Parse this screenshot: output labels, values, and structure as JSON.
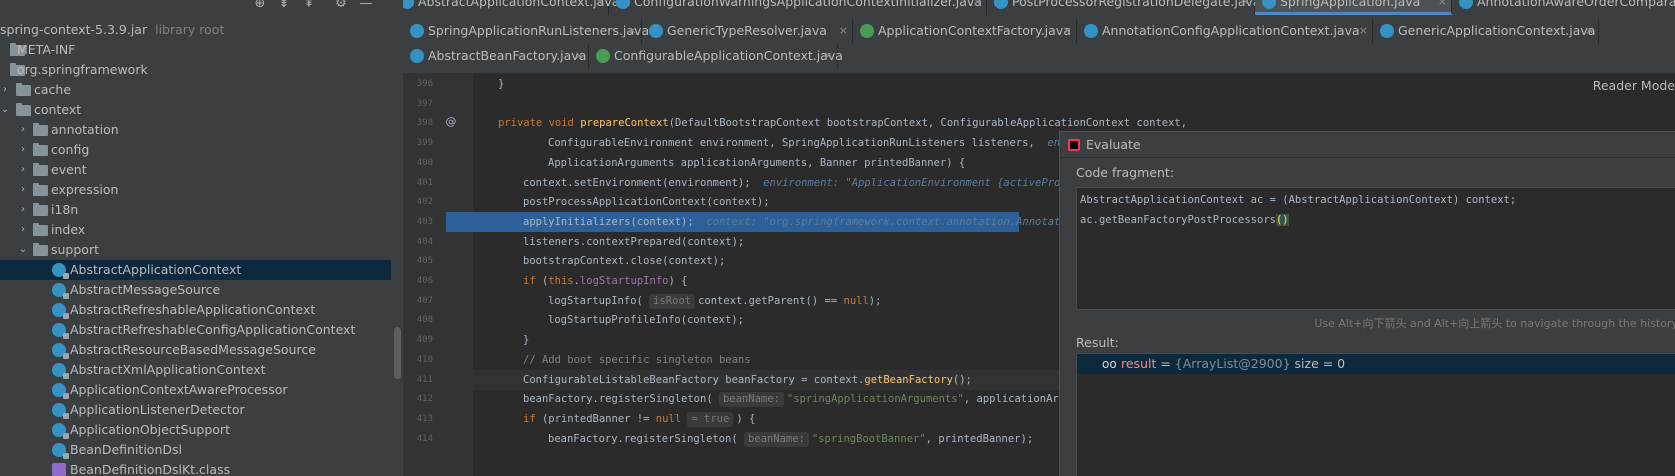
{
  "project": {
    "toolbar_icons": [
      "locate-icon",
      "collapse-all-icon",
      "expand-all-icon",
      "gear-icon",
      "minimize-icon"
    ],
    "tree": [
      {
        "label": "spring-context-5.3.9.jar",
        "sub": "library root",
        "icon": "jar-icon",
        "indent": 0,
        "arrow": ""
      },
      {
        "label": "META-INF",
        "icon": "folder-icon",
        "indent": 1,
        "arrow": ""
      },
      {
        "label": "org.springframework",
        "icon": "folder-icon",
        "indent": 1,
        "arrow": ""
      },
      {
        "label": "cache",
        "icon": "folder-icon",
        "indent": 1,
        "arrow": "›"
      },
      {
        "label": "context",
        "icon": "folder-icon",
        "indent": 1,
        "arrow": "⌄"
      },
      {
        "label": "annotation",
        "icon": "folder-icon",
        "indent": 2,
        "arrow": "›"
      },
      {
        "label": "config",
        "icon": "folder-icon",
        "indent": 2,
        "arrow": "›"
      },
      {
        "label": "event",
        "icon": "folder-icon",
        "indent": 2,
        "arrow": "›"
      },
      {
        "label": "expression",
        "icon": "folder-icon",
        "indent": 2,
        "arrow": "›"
      },
      {
        "label": "i18n",
        "icon": "folder-icon",
        "indent": 2,
        "arrow": "›"
      },
      {
        "label": "index",
        "icon": "folder-icon",
        "indent": 2,
        "arrow": "›"
      },
      {
        "label": "support",
        "icon": "folder-icon",
        "indent": 2,
        "arrow": "⌄"
      },
      {
        "label": "AbstractApplicationContext",
        "icon": "class-icon",
        "indent": 3,
        "arrow": "",
        "selected": true
      },
      {
        "label": "AbstractMessageSource",
        "icon": "class-icon",
        "indent": 3,
        "arrow": ""
      },
      {
        "label": "AbstractRefreshableApplicationContext",
        "icon": "class-icon",
        "indent": 3,
        "arrow": ""
      },
      {
        "label": "AbstractRefreshableConfigApplicationContext",
        "icon": "class-icon",
        "indent": 3,
        "arrow": ""
      },
      {
        "label": "AbstractResourceBasedMessageSource",
        "icon": "class-icon",
        "indent": 3,
        "arrow": ""
      },
      {
        "label": "AbstractXmlApplicationContext",
        "icon": "class-icon",
        "indent": 3,
        "arrow": ""
      },
      {
        "label": "ApplicationContextAwareProcessor",
        "icon": "class-icon",
        "indent": 3,
        "arrow": ""
      },
      {
        "label": "ApplicationListenerDetector",
        "icon": "class-icon",
        "indent": 3,
        "arrow": ""
      },
      {
        "label": "ApplicationObjectSupport",
        "icon": "class-icon",
        "indent": 3,
        "arrow": ""
      },
      {
        "label": "BeanDefinitionDsl",
        "icon": "class-icon",
        "indent": 3,
        "arrow": ""
      },
      {
        "label": "BeanDefinitionDslKt.class",
        "icon": "kotlin-class-icon",
        "indent": 3,
        "arrow": ""
      }
    ]
  },
  "tabs": {
    "row1": [
      {
        "label": "AbstractApplicationContext.java",
        "icon": "class",
        "active": false
      },
      {
        "label": "ConfigurationWarningsApplicationContextInitializer.java",
        "icon": "class",
        "active": false
      },
      {
        "label": "PostProcessorRegistrationDelegate.java",
        "icon": "class",
        "active": false
      },
      {
        "label": "SpringApplication.java",
        "icon": "class",
        "active": true
      },
      {
        "label": "AnnotationAwareOrderComparator.java",
        "icon": "class",
        "active": false
      }
    ],
    "row2": [
      {
        "label": "SpringApplicationRunListeners.java",
        "icon": "class"
      },
      {
        "label": "GenericTypeResolver.java",
        "icon": "class"
      },
      {
        "label": "ApplicationContextFactory.java",
        "icon": "interface"
      },
      {
        "label": "AnnotationConfigApplicationContext.java",
        "icon": "class"
      },
      {
        "label": "GenericApplicationContext.java",
        "icon": "class"
      }
    ],
    "row3": [
      {
        "label": "AbstractBeanFactory.java",
        "icon": "class"
      },
      {
        "label": "ConfigurableApplicationContext.java",
        "icon": "interface"
      }
    ],
    "close_glyph": "×"
  },
  "editor": {
    "reader_mode": "Reader Mode",
    "lines": [
      {
        "n": "396",
        "html": "<span class='ws' style='width:25px'></span>}"
      },
      {
        "n": "397",
        "html": ""
      },
      {
        "n": "398",
        "html": "<span class='ws' style='width:25px'></span><span class='kw'>private void </span><span class='fn'>prepareContext</span>(DefaultBootstrapContext bootstrapContext, ConfigurableApplicationContext context,",
        "mark": "@"
      },
      {
        "n": "399",
        "html": "<span class='ws' style='width:75px'></span>ConfigurableEnvironment environment, SpringApplicationRunListeners listeners,  <span class='inline'>environment: \"ApplicationEnvironment {activeProfiles=[], defaultProfiles=[default]}\"</span>"
      },
      {
        "n": "400",
        "html": "<span class='ws' style='width:75px'></span>ApplicationArguments applicationArguments, Banner printedBanner) {"
      },
      {
        "n": "401",
        "html": "<span class='ws' style='width:50px'></span>context.setEnvironment(environment);  <span class='inline'>environment: \"ApplicationEnvironment {activeProfiles=[], defaultProfiles=[default]}\"</span>"
      },
      {
        "n": "402",
        "html": "<span class='ws' style='width:50px'></span>postProcessApplicationContext(context);"
      },
      {
        "n": "403",
        "html": "<span class='ws' style='width:50px'></span>applyInitializers(context);  <span class='inline'>context: \"org.springframework.context.annotation.AnnotationConfigApplicationContext\"</span>",
        "exec": true,
        "mark": "bp"
      },
      {
        "n": "404",
        "html": "<span class='ws' style='width:50px'></span>listeners.contextPrepared(context);"
      },
      {
        "n": "405",
        "html": "<span class='ws' style='width:50px'></span>bootstrapContext.close(context);"
      },
      {
        "n": "406",
        "html": "<span class='ws' style='width:50px'></span><span class='kw'>if </span>(<span class='kw'>this</span>.<span class='fld'>logStartupInfo</span>) {"
      },
      {
        "n": "407",
        "html": "<span class='ws' style='width:75px'></span>logStartupInfo( <span class='hint'>isRoot</span>context.getParent() == <span class='kw'>null</span>);"
      },
      {
        "n": "408",
        "html": "<span class='ws' style='width:75px'></span>logStartupProfileInfo(context);"
      },
      {
        "n": "409",
        "html": "<span class='ws' style='width:50px'></span>}"
      },
      {
        "n": "410",
        "html": "<span class='ws' style='width:50px'></span><span class='cm'>// Add boot specific singleton beans</span>"
      },
      {
        "n": "411",
        "html": "<span class='ws' style='width:50px'></span>ConfigurableListableBeanFactory beanFactory = context.<span class='fn'>getBeanFactory</span>();",
        "current": true
      },
      {
        "n": "412",
        "html": "<span class='ws' style='width:50px'></span>beanFactory.registerSingleton( <span class='hint'>beanName:</span><span class='str'>\"springApplicationArguments\"</span>, applicationArguments);"
      },
      {
        "n": "413",
        "html": "<span class='ws' style='width:50px'></span><span class='kw'>if </span>(printedBanner != <span class='kw'>null</span> <span class='hint'>= true</span>) {"
      },
      {
        "n": "414",
        "html": "<span class='ws' style='width:75px'></span>beanFactory.registerSingleton( <span class='hint'>beanName:</span><span class='str'>\"springBootBanner\"</span>, printedBanner);"
      }
    ]
  },
  "evaluate": {
    "title": "Evaluate",
    "fragment_label": "Code fragment:",
    "fragment_line1": "AbstractApplicationContext ac = (AbstractApplicationContext) context;",
    "fragment_line2_pre": "ac.getBeanFactoryPostProcessors",
    "fragment_line2_paren": "()",
    "history_hint": "Use Alt+向下箭头 and Alt+向上箭头 to navigate through the history",
    "result_label": "Result:",
    "result_icon": "oo",
    "result_name": "result",
    "result_eq": " = ",
    "result_type": "{ArrayList@2900}",
    "result_size": "  size = 0"
  }
}
